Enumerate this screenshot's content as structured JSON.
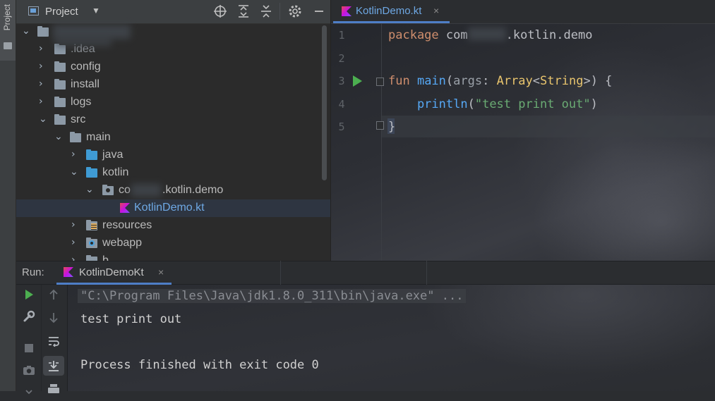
{
  "left_stripe": {
    "project_label": "Project"
  },
  "project_panel": {
    "title": "Project",
    "dropdown": "▼",
    "tree": [
      {
        "label": ".idea",
        "kind": "folder",
        "expanded": false
      },
      {
        "label": "config",
        "kind": "folder",
        "expanded": false
      },
      {
        "label": "install",
        "kind": "folder",
        "expanded": false
      },
      {
        "label": "logs",
        "kind": "folder",
        "expanded": false
      },
      {
        "label": "src",
        "kind": "folder",
        "expanded": true
      },
      {
        "label": "main",
        "kind": "folder",
        "expanded": true
      },
      {
        "label": "java",
        "kind": "source-folder",
        "expanded": false
      },
      {
        "label": "kotlin",
        "kind": "source-folder",
        "expanded": true
      },
      {
        "label_prefix": "co",
        "label_suffix": ".kotlin.demo",
        "kind": "package",
        "expanded": true
      },
      {
        "label": "KotlinDemo.kt",
        "kind": "kotlin-file",
        "selected": true
      },
      {
        "label": "resources",
        "kind": "resources-folder",
        "expanded": false
      },
      {
        "label": "webapp",
        "kind": "web-folder",
        "expanded": false
      },
      {
        "label": "b",
        "kind": "folder",
        "expanded": false
      }
    ]
  },
  "editor": {
    "tab_label": "KotlinDemo.kt",
    "tab_close": "×",
    "line_numbers": [
      "1",
      "2",
      "3",
      "4",
      "5"
    ],
    "code": {
      "l1_kw": "package",
      "l1_prefix": " com",
      "l1_suffix": ".kotlin.demo",
      "l3_kw": "fun",
      "l3_name": " main",
      "l3_open": "(",
      "l3_param": "args",
      "l3_colon": ": ",
      "l3_type1": "Array",
      "l3_lt": "<",
      "l3_type2": "String",
      "l3_gt": ">",
      "l3_close": ") {",
      "l4_fn": "    println",
      "l4_open": "(",
      "l4_str": "\"test print out\"",
      "l4_close": ")",
      "l5_brace": "}"
    }
  },
  "run_window": {
    "label": "Run:",
    "tab_label": "KotlinDemoKt",
    "tab_close": "×",
    "console": {
      "cmd": "\"C:\\Program Files\\Java\\jdk1.8.0_311\\bin\\java.exe\" ...",
      "output": "test print out",
      "finished": "Process finished with exit code 0"
    }
  },
  "colors": {
    "accent": "#4e7ec7",
    "run_green": "#4caf50",
    "keyword": "#cf8e6d",
    "function": "#56a8f5",
    "type": "#e8c46d",
    "string": "#6aab73",
    "file_blue": "#6ea8e4"
  }
}
